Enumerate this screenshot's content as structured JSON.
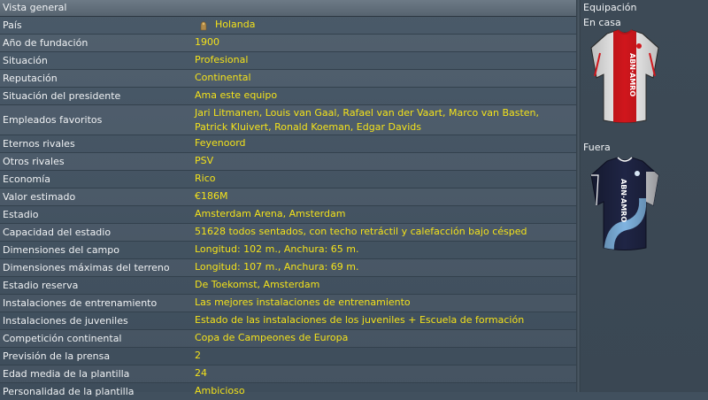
{
  "overview": {
    "title": "Vista general",
    "rows": [
      {
        "label": "País",
        "value": "Holanda",
        "flag_icon": "netherlands-lion-icon"
      },
      {
        "label": "Año de fundación",
        "value": "1900"
      },
      {
        "label": "Situación",
        "value": "Profesional"
      },
      {
        "label": "Reputación",
        "value": "Continental"
      },
      {
        "label": "Situación del presidente",
        "value": "Ama este equipo"
      },
      {
        "label": "Empleados favoritos",
        "value": "Jari Litmanen, Louis van Gaal, Rafael van der Vaart, Marco van Basten, Patrick Kluivert, Ronald Koeman, Edgar Davids"
      },
      {
        "label": "Eternos rivales",
        "value": "Feyenoord"
      },
      {
        "label": "Otros rivales",
        "value": "PSV"
      },
      {
        "label": "Economía",
        "value": "Rico"
      },
      {
        "label": "Valor estimado",
        "value": "€186M"
      },
      {
        "label": "Estadio",
        "value": "Amsterdam Arena, Amsterdam"
      },
      {
        "label": "Capacidad del estadio",
        "value": "51628 todos sentados, con techo retráctil y calefacción bajo césped"
      },
      {
        "label": "Dimensiones del campo",
        "value": "Longitud: 102 m., Anchura: 65 m."
      },
      {
        "label": "Dimensiones máximas del terreno",
        "value": "Longitud: 107 m., Anchura: 69 m."
      },
      {
        "label": "Estadio reserva",
        "value": "De Toekomst, Amsterdam"
      },
      {
        "label": "Instalaciones de entrenamiento",
        "value": "Las mejores instalaciones de entrenamiento"
      },
      {
        "label": "Instalaciones de juveniles",
        "value": "Estado de las instalaciones de los juveniles + Escuela de formación"
      },
      {
        "label": "Competición continental",
        "value": "Copa de Campeones de Europa"
      },
      {
        "label": "Previsión de la prensa",
        "value": "2"
      },
      {
        "label": "Edad media de la plantilla",
        "value": "24"
      },
      {
        "label": "Personalidad de la plantilla",
        "value": "Ambicioso"
      }
    ]
  },
  "kits": {
    "title": "Equipación",
    "home_label": "En casa",
    "away_label": "Fuera",
    "sponsor": "ABN·AMRO",
    "home_colors": {
      "body": "#f4f4f4",
      "stripe": "#d0161c"
    },
    "away_colors": {
      "body": "#1f2545",
      "accent": "#7fb3e0"
    }
  },
  "colors": {
    "value_text": "#f4e21a",
    "label_text": "#f0f2f4"
  }
}
